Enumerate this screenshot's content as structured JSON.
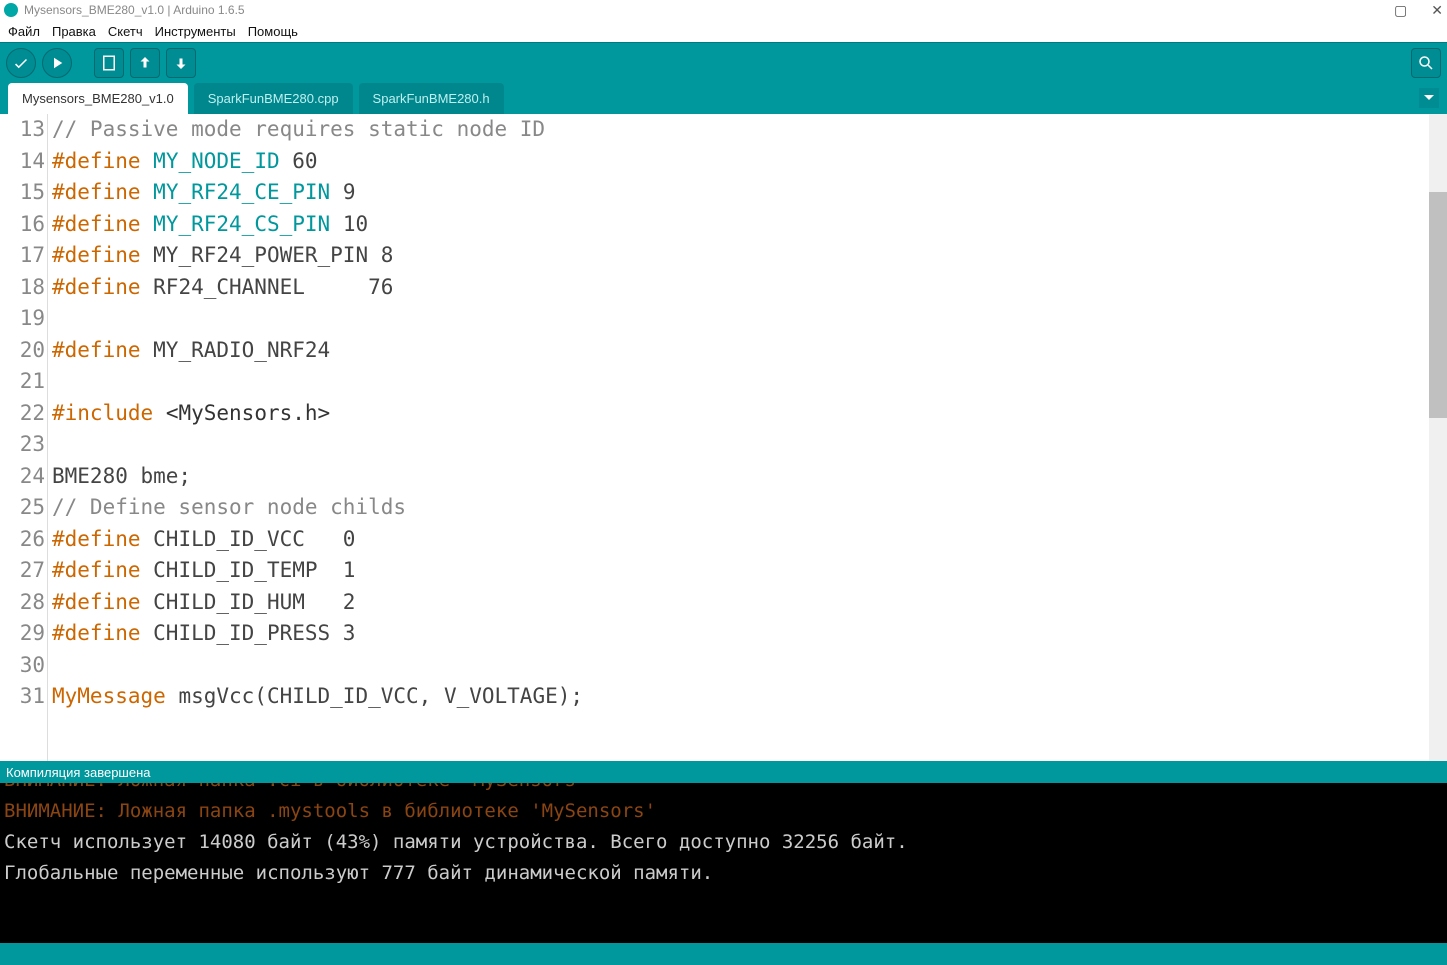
{
  "window": {
    "title": "Mysensors_BME280_v1.0 | Arduino 1.6.5",
    "controls": {
      "max": "▢",
      "close": "✕"
    }
  },
  "menu": {
    "file": "Файл",
    "edit": "Правка",
    "sketch": "Скетч",
    "tools": "Инструменты",
    "help": "Помощь"
  },
  "tabs": {
    "items": [
      {
        "label": "Mysensors_BME280_v1.0"
      },
      {
        "label": "SparkFunBME280.cpp"
      },
      {
        "label": "SparkFunBME280.h"
      }
    ]
  },
  "code": {
    "lines": [
      {
        "n": 13,
        "html": "<span class='gray'>// Passive mode requires static node ID</span>"
      },
      {
        "n": 14,
        "html": "<span class='orange'>#define</span> <span class='teal'>MY_NODE_ID</span> 60"
      },
      {
        "n": 15,
        "html": "<span class='orange'>#define</span> <span class='teal'>MY_RF24_CE_PIN</span> 9"
      },
      {
        "n": 16,
        "html": "<span class='orange'>#define</span> <span class='teal'>MY_RF24_CS_PIN</span> 10"
      },
      {
        "n": 17,
        "html": "<span class='orange'>#define</span> MY_RF24_POWER_PIN 8"
      },
      {
        "n": 18,
        "html": "<span class='orange'>#define</span> RF24_CHANNEL     76"
      },
      {
        "n": 19,
        "html": ""
      },
      {
        "n": 20,
        "html": "<span class='orange'>#define</span> MY_RADIO_NRF24"
      },
      {
        "n": 21,
        "html": ""
      },
      {
        "n": 22,
        "html": "<span class='orange'>#include</span> <span class='dk'>&lt;MySensors.h&gt;</span>"
      },
      {
        "n": 23,
        "html": ""
      },
      {
        "n": 24,
        "html": "BME280 bme;"
      },
      {
        "n": 25,
        "html": "<span class='gray'>// Define sensor node childs</span>"
      },
      {
        "n": 26,
        "html": "<span class='orange'>#define</span> CHILD_ID_VCC   0"
      },
      {
        "n": 27,
        "html": "<span class='orange'>#define</span> CHILD_ID_TEMP  1"
      },
      {
        "n": 28,
        "html": "<span class='orange'>#define</span> CHILD_ID_HUM   2"
      },
      {
        "n": 29,
        "html": "<span class='orange'>#define</span> CHILD_ID_PRESS 3"
      },
      {
        "n": 30,
        "html": ""
      },
      {
        "n": 31,
        "html": "<span class='orange'>MyMessage</span> msgVcc(CHILD_ID_VCC, V_VOLTAGE);"
      }
    ]
  },
  "status": {
    "text": "Компиляция завершена"
  },
  "console": {
    "lines": [
      {
        "html": "<span class='brown'>ВНИМАНИЕ: Ложная папка .ci в библиотеке 'MySensors'</span>"
      },
      {
        "html": "<span class='brown'>ВНИМАНИЕ: Ложная папка .mystools в библиотеке 'MySensors'</span>"
      },
      {
        "html": "Скетч использует 14080 байт (43%) памяти устройства. Всего доступно 32256 байт."
      },
      {
        "html": "Глобальные переменные используют 777 байт динамической памяти."
      }
    ]
  }
}
